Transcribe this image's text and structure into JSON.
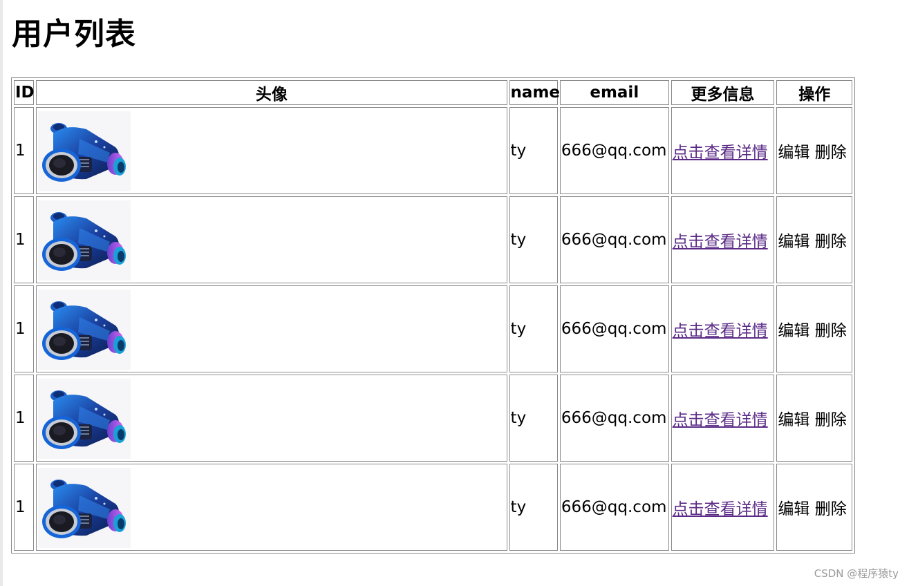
{
  "page": {
    "title": "用户列表"
  },
  "table": {
    "headers": {
      "id": "ID",
      "avatar": "头像",
      "name": "name",
      "email": "email",
      "more": "更多信息",
      "action": "操作"
    },
    "rows": [
      {
        "id": "1",
        "name": "ty",
        "email": "666@qq.com",
        "detail": "点击查看详情",
        "edit": "编辑",
        "delete": "删除"
      },
      {
        "id": "1",
        "name": "ty",
        "email": "666@qq.com",
        "detail": "点击查看详情",
        "edit": "编辑",
        "delete": "删除"
      },
      {
        "id": "1",
        "name": "ty",
        "email": "666@qq.com",
        "detail": "点击查看详情",
        "edit": "编辑",
        "delete": "删除"
      },
      {
        "id": "1",
        "name": "ty",
        "email": "666@qq.com",
        "detail": "点击查看详情",
        "edit": "编辑",
        "delete": "删除"
      },
      {
        "id": "1",
        "name": "ty",
        "email": "666@qq.com",
        "detail": "点击查看详情",
        "edit": "编辑",
        "delete": "删除"
      }
    ]
  },
  "watermark": "CSDN @程序猿ty",
  "colors": {
    "link_visited": "#5a2a86",
    "border": "#8a8a8a",
    "avatar_blue": "#1d6fd6",
    "avatar_purple": "#b44fd8"
  },
  "icons": {
    "avatar": "camera-lens-image"
  }
}
